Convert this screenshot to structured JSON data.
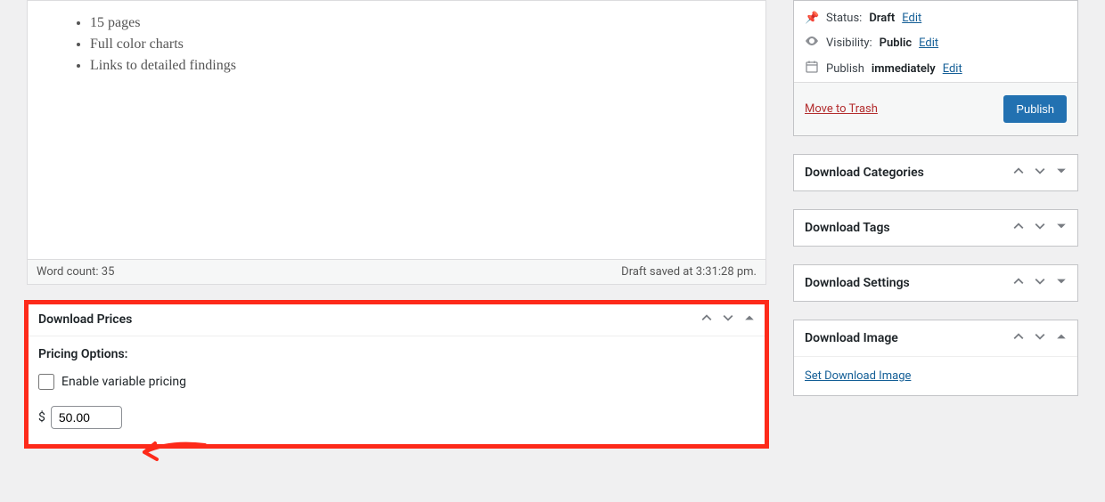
{
  "editor": {
    "bullets": [
      "15 pages",
      "Full color charts",
      "Links to detailed findings"
    ],
    "word_count_label": "Word count: 35",
    "draft_saved_label": "Draft saved at 3:31:28 pm."
  },
  "prices_box": {
    "title": "Download Prices",
    "options_label": "Pricing Options:",
    "variable_label": "Enable variable pricing",
    "currency": "$",
    "price_value": "50.00"
  },
  "publish": {
    "status_label": "Status:",
    "status_value": "Draft",
    "visibility_label": "Visibility:",
    "visibility_value": "Public",
    "publish_label": "Publish",
    "publish_value": "immediately",
    "edit_label": "Edit",
    "trash_label": "Move to Trash",
    "publish_button": "Publish"
  },
  "side_panels": {
    "categories": "Download Categories",
    "tags": "Download Tags",
    "settings": "Download Settings",
    "image": "Download Image",
    "set_image_link": "Set Download Image"
  }
}
